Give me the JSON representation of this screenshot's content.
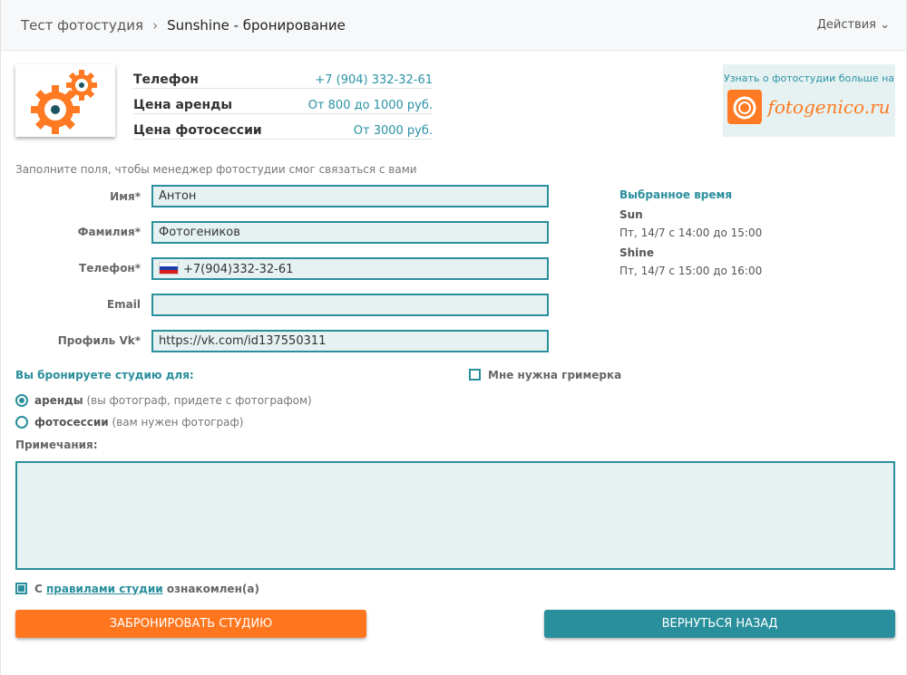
{
  "header": {
    "breadcrumb": [
      "Тест фотостудия",
      "Sunshine - бронирование"
    ],
    "separator": "›",
    "actions": "Действия ⌄"
  },
  "info": [
    {
      "k": "Телефон",
      "v": "+7 (904) 332-32-61"
    },
    {
      "k": "Цена аренды",
      "v": "От 800 до 1000 руб."
    },
    {
      "k": "Цена фотосессии",
      "v": "От 3000 руб."
    }
  ],
  "banner": {
    "text": "Узнать о фотостудии больше на",
    "brand": "fotogenico.ru"
  },
  "form": {
    "hint": "Заполните поля, чтобы менеджер фотостудии смог связаться с вами",
    "fields": [
      {
        "label": "Имя*",
        "value": "Антон"
      },
      {
        "label": "Фамилия*",
        "value": "Фотогеников"
      },
      {
        "label": "Телефон*",
        "value": "+7(904)332-32-61"
      },
      {
        "label": "Email",
        "value": ""
      },
      {
        "label": "Профиль Vk*",
        "value": "https://vk.com/id137550311"
      }
    ]
  },
  "selected": {
    "title": "Выбранное время",
    "items": [
      {
        "name": "Sun",
        "time": "Пт, 14/7 с 14:00 до 15:00"
      },
      {
        "name": "Shine",
        "time": "Пт, 14/7 с 15:00 до 16:00"
      }
    ]
  },
  "booking": {
    "title": "Вы бронируете студию для:",
    "options": [
      {
        "bold": "аренды",
        "rest": " (вы фотограф, придете с фотографом)",
        "checked": true
      },
      {
        "bold": "фотосессии",
        "rest": " (вам нужен фотограф)",
        "checked": false
      }
    ],
    "makeup": "Мне нужна гримерка"
  },
  "notes_label": "Примечания:",
  "agree": {
    "pre": "С ",
    "link": "правилами студии",
    "post": " ознакомлен(а)",
    "checked": true
  },
  "buttons": {
    "book": "ЗАБРОНИРОВАТЬ СТУДИЮ",
    "back": "ВЕРНУТЬСЯ НАЗАД"
  },
  "colors": {
    "teal": "#2a8f9c",
    "orange": "#ff761f",
    "input_bg": "#e6f2f1"
  }
}
